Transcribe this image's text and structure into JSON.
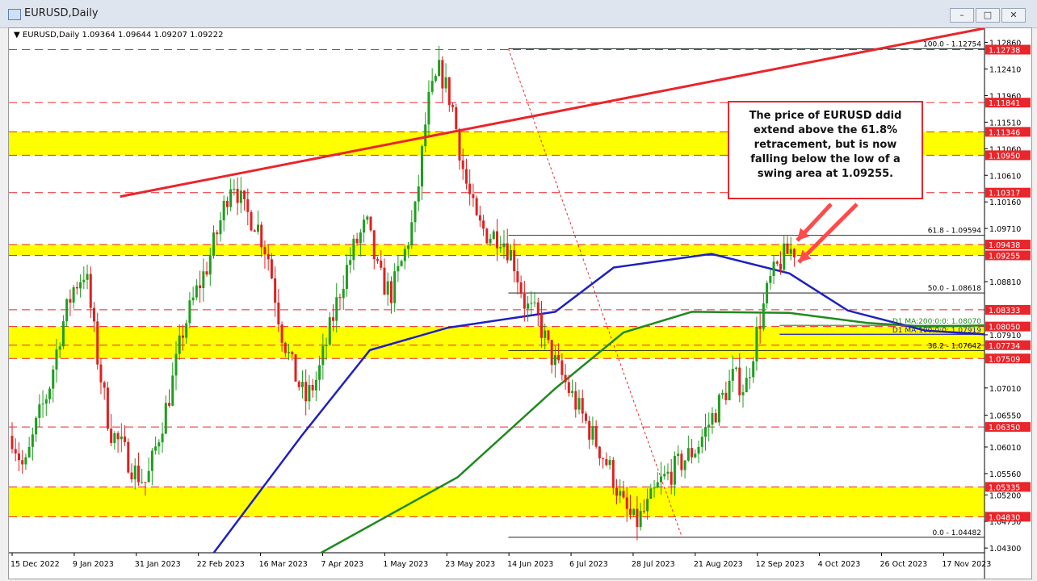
{
  "window": {
    "title": "EURUSD,Daily",
    "buttons": [
      "minimize",
      "restore",
      "close"
    ]
  },
  "chart_header": {
    "symbol": "EURUSD,Daily",
    "ohlc": "1.09364 1.09644 1.09207 1.09222"
  },
  "annotation_text": "The price of EURUSD ddid extend above the 61.8% retracement, but is now falling below the low of a swing area at 1.09255.",
  "colors": {
    "yellow_zone": "#ffff00",
    "red_level": "#e8262b",
    "ma100": "#2020c0",
    "ma200": "#1f8a1f",
    "bull": "#1e9e1e",
    "bear": "#e02020",
    "trendline": "#e8262b"
  },
  "chart_data": {
    "type": "candlestick",
    "symbol": "EURUSD",
    "timeframe": "Daily",
    "ylim": [
      1.0422,
      1.131
    ],
    "yticks": [
      1.1286,
      1.1241,
      1.1196,
      1.1151,
      1.1106,
      1.1061,
      1.1016,
      1.0971,
      1.0881,
      1.0791,
      1.0701,
      1.0655,
      1.0601,
      1.0556,
      1.052,
      1.0475,
      1.043
    ],
    "x_labels": [
      "15 Dec 2022",
      "9 Jan 2023",
      "31 Jan 2023",
      "22 Feb 2023",
      "16 Mar 2023",
      "7 Apr 2023",
      "1 May 2023",
      "23 May 2023",
      "14 Jun 2023",
      "6 Jul 2023",
      "28 Jul 2023",
      "21 Aug 2023",
      "12 Sep 2023",
      "4 Oct 2023",
      "26 Oct 2023",
      "17 Nov 2023"
    ],
    "yellow_zones": [
      [
        1.1095,
        1.11346
      ],
      [
        1.09255,
        1.09438
      ],
      [
        1.0773,
        1.0805
      ],
      [
        1.07509,
        1.0773
      ],
      [
        1.0483,
        1.05335
      ]
    ],
    "red_levels": [
      1.12738,
      1.11841,
      1.11346,
      1.1095,
      1.10317,
      1.09438,
      1.09255,
      1.08333,
      1.0805,
      1.07734,
      1.07509,
      1.0635,
      1.05335,
      1.0483
    ],
    "price_tags": [
      "1.12738",
      "1.11841",
      "1.11346",
      "1.10950",
      "1.10317",
      "1.09438",
      "1.09255",
      "1.08333",
      "1.08050",
      "1.07734",
      "1.07509",
      "1.06350",
      "1.05335",
      "1.04830"
    ],
    "fib_levels": [
      {
        "label": "100.0 - 1.12754",
        "value": 1.12754
      },
      {
        "label": "61.8 - 1.09594",
        "value": 1.09594
      },
      {
        "label": "50.0 - 1.08618",
        "value": 1.08618
      },
      {
        "label": "38.2 - 1.07642",
        "value": 1.07642
      },
      {
        "label": "0.0 - 1.04482",
        "value": 1.04482
      }
    ],
    "ma_labels": [
      {
        "label": "D1 MA:200:0:0: 1.08070",
        "value": 1.0807
      },
      {
        "label": "D1 MA:100:0:0: 1.07919",
        "value": 1.07919
      }
    ],
    "trendline": {
      "from": [
        "31 Jan 2023",
        1.1025
      ],
      "to": [
        "Nov 2023",
        1.131
      ]
    },
    "ma100": [
      [
        0.21,
        1.0422
      ],
      [
        0.3,
        1.062
      ],
      [
        0.37,
        1.0765
      ],
      [
        0.45,
        1.0803
      ],
      [
        0.56,
        1.083
      ],
      [
        0.62,
        1.0905
      ],
      [
        0.72,
        1.0928
      ],
      [
        0.8,
        1.0895
      ],
      [
        0.86,
        1.0832
      ],
      [
        0.94,
        1.0798
      ],
      [
        1.0,
        1.0792
      ]
    ],
    "ma200": [
      [
        0.32,
        1.0422
      ],
      [
        0.46,
        1.055
      ],
      [
        0.56,
        1.07
      ],
      [
        0.63,
        1.0795
      ],
      [
        0.7,
        1.083
      ],
      [
        0.8,
        1.0828
      ],
      [
        0.88,
        1.0811
      ],
      [
        0.94,
        1.0805
      ],
      [
        1.0,
        1.0807
      ]
    ],
    "price_path": [
      1.062,
      1.056,
      1.064,
      1.07,
      1.08,
      1.087,
      1.09,
      1.075,
      1.063,
      1.06,
      1.056,
      1.054,
      1.062,
      1.07,
      1.08,
      1.086,
      1.091,
      1.098,
      1.106,
      1.1,
      1.098,
      1.092,
      1.08,
      1.073,
      1.068,
      1.072,
      1.08,
      1.088,
      1.094,
      1.098,
      1.089,
      1.086,
      1.092,
      1.1,
      1.118,
      1.124,
      1.118,
      1.106,
      1.098,
      1.096,
      1.096,
      1.092,
      1.084,
      1.082,
      1.076,
      1.072,
      1.068,
      1.064,
      1.06,
      1.056,
      1.05,
      1.047,
      1.05,
      1.054,
      1.056,
      1.058,
      1.06,
      1.064,
      1.068,
      1.072,
      1.07,
      1.08,
      1.088,
      1.092,
      1.094
    ],
    "last_price": 1.09222
  }
}
